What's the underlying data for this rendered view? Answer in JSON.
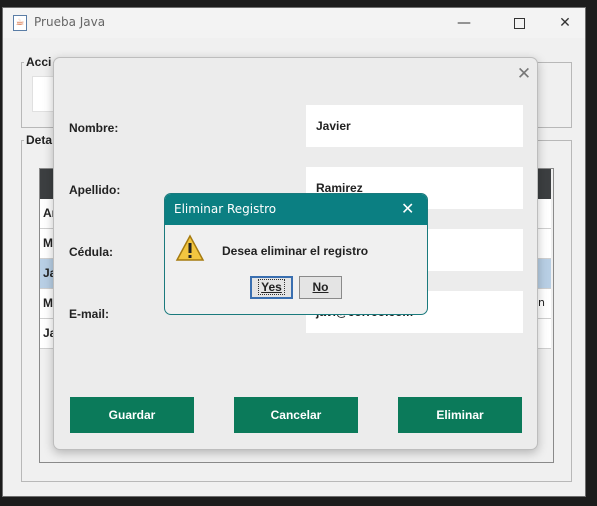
{
  "window": {
    "title": "Prueba Java",
    "icon": "java-cup-icon"
  },
  "groups": {
    "acciones": "Acci",
    "detalles": "Deta"
  },
  "table": {
    "rows": [
      {
        "left": "An",
        "right": "",
        "selected": false
      },
      {
        "left": "Ma",
        "right": "",
        "selected": false
      },
      {
        "left": "Ja",
        "right": "",
        "selected": true
      },
      {
        "left": "Ma",
        "right": "n",
        "selected": false
      },
      {
        "left": "Ja",
        "right": "",
        "selected": false
      }
    ]
  },
  "form": {
    "fields": [
      {
        "label": "Nombre:",
        "value": "Javier"
      },
      {
        "label": "Apellido:",
        "value": "Ramirez"
      },
      {
        "label": "Cédula:",
        "value": ""
      },
      {
        "label": "E-mail:",
        "value": "javi@correo.com"
      }
    ],
    "buttons": {
      "save": "Guardar",
      "cancel": "Cancelar",
      "delete": "Eliminar"
    }
  },
  "confirm": {
    "title": "Eliminar Registro",
    "message": "Desea eliminar el registro",
    "yes": "Yes",
    "no": "No",
    "icon": "warning-icon"
  },
  "colors": {
    "accent_green": "#0b7a5a",
    "dialog_teal": "#0b7f82",
    "selected_row": "#b8cfe5",
    "table_header": "#3c3f41"
  }
}
